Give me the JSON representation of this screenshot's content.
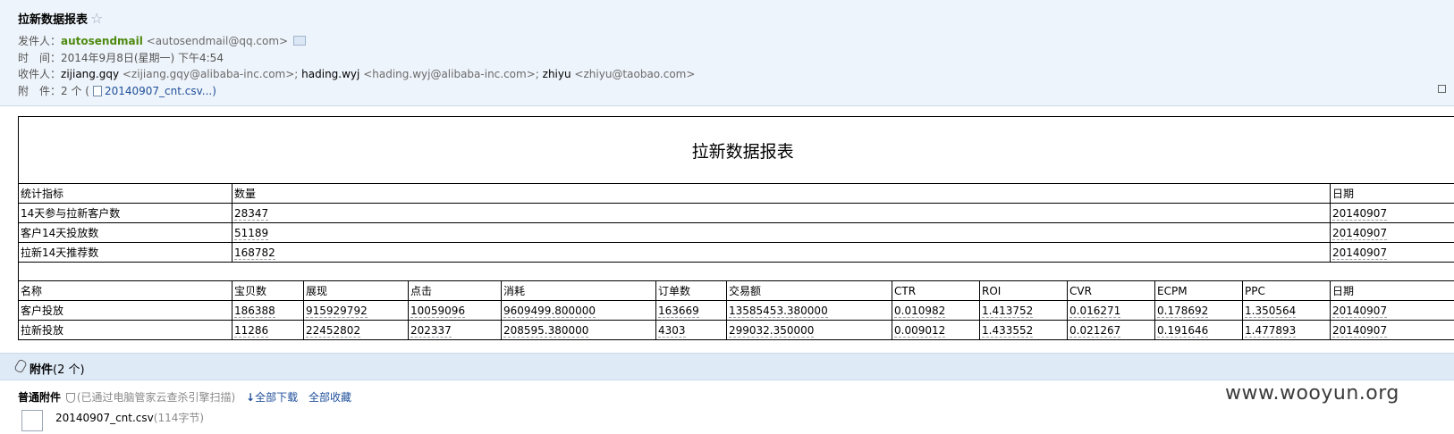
{
  "email": {
    "subject": "拉新数据报表",
    "star_icon": "star-outline-icon",
    "sender_label": "发件人：",
    "sender_name": "autosendmail",
    "sender_addr": "<autosendmail@qq.com>",
    "time_label": "时　间：",
    "time_value": "2014年9月8日(星期一) 下午4:54",
    "recipients_label": "收件人：",
    "recipients": [
      {
        "name": "zijiang.gqy",
        "addr": "<zijiang.gqy@alibaba-inc.com>;"
      },
      {
        "name": "hading.wyj",
        "addr": "<hading.wyj@alibaba-inc.com>;"
      },
      {
        "name": "zhiyu",
        "addr": "<zhiyu@taobao.com>"
      }
    ],
    "attach_label": "附　件：",
    "attach_count": "2 个 (",
    "attach_first": "20140907_cnt.csv...)"
  },
  "report": {
    "title": "拉新数据报表",
    "summary_headers": [
      "统计指标",
      "数量",
      "日期"
    ],
    "summary_rows": [
      [
        "14天参与拉新客户数",
        "28347",
        "20140907"
      ],
      [
        "客户14天投放数",
        "51189",
        "20140907"
      ],
      [
        "拉新14天推荐数",
        "168782",
        "20140907"
      ]
    ],
    "detail_headers": [
      "名称",
      "宝贝数",
      "展现",
      "点击",
      "消耗",
      "订单数",
      "交易额",
      "CTR",
      "ROI",
      "CVR",
      "ECPM",
      "PPC",
      "日期"
    ],
    "detail_rows": [
      [
        "客户投放",
        "186388",
        "915929792",
        "10059096",
        "9609499.800000",
        "163669",
        "13585453.380000",
        "0.010982",
        "1.413752",
        "0.016271",
        "0.178692",
        "1.350564",
        "20140907"
      ],
      [
        "拉新投放",
        "11286",
        "22452802",
        "202337",
        "208595.380000",
        "4303",
        "299032.350000",
        "0.009012",
        "1.433552",
        "0.021267",
        "0.191646",
        "1.477893",
        "20140907"
      ]
    ]
  },
  "attachments": {
    "section_title": "附件",
    "section_count": "(2 个)",
    "normal_label": "普通附件",
    "scan_note": "(已通过电脑管家云查杀引擎扫描)",
    "download_all": "全部下载",
    "save_all": "全部收藏",
    "file_name": "20140907_cnt.csv",
    "file_size": "(114字节)"
  },
  "watermark": "www.wooyun.org"
}
